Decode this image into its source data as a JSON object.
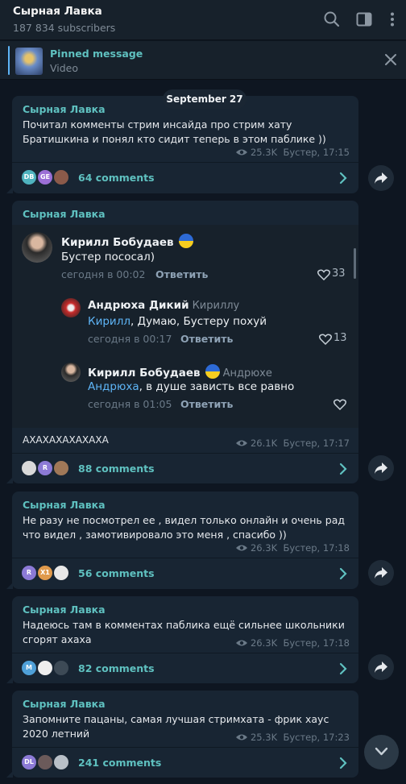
{
  "channel": {
    "title": "Сырная Лавка",
    "subscribers": "187 834 subscribers"
  },
  "header_icons": [
    "search-icon",
    "sidebar-toggle-icon",
    "more-vertical-icon"
  ],
  "pinned": {
    "title": "Pinned message",
    "subtitle": "Video"
  },
  "date_separator": "September 27",
  "posts": [
    {
      "sender": "Сырная Лавка",
      "text": "Почитал комменты стрим инсайда про стрим хату Братишкина и понял кто сидит теперь в этом паблике ))",
      "views": "25.3K",
      "author_time": "Бустер, 17:15",
      "avatars": [
        "DB",
        "GE",
        ""
      ],
      "comments": "64 comments"
    },
    {
      "sender": "Сырная Лавка",
      "text": "АХАХАХАХАХАХА",
      "views": "26.1K",
      "author_time": "Бустер, 17:17",
      "avatars": [
        "",
        "R",
        ""
      ],
      "comments": "88 comments",
      "embedded_comments": [
        {
          "name": "Кирилл Бобудаев",
          "text": "Бустер пососал)",
          "time": "сегодня в 00:02",
          "answer": "Ответить",
          "likes": "33"
        },
        {
          "name": "Андрюха Дикий",
          "reply_to": "Кириллу",
          "mention": "Кирилл",
          "text": ", Думаю, Бустеру похуй",
          "time": "сегодня в 00:17",
          "answer": "Ответить",
          "likes": "13"
        },
        {
          "name": "Кирилл Бобудаев",
          "reply_to": "Андрюхе",
          "mention": "Андрюха",
          "text": ", в душе зависть все равно",
          "time": "сегодня в 01:05",
          "answer": "Ответить",
          "likes": ""
        }
      ]
    },
    {
      "sender": "Сырная Лавка",
      "text": "Не разу не посмотрел ее , видел только онлайн и очень рад что видел , замотивировало это меня , спасибо ))",
      "views": "26.3K",
      "author_time": "Бустер, 17:18",
      "avatars": [
        "R",
        "X1",
        ""
      ],
      "comments": "56 comments"
    },
    {
      "sender": "Сырная Лавка",
      "text": "Надеюсь там в комментах паблика ещё сильнее школьники сгорят ахаха",
      "views": "26.3K",
      "author_time": "Бустер, 17:18",
      "avatars": [
        "M",
        "",
        ""
      ],
      "comments": "82 comments"
    },
    {
      "sender": "Сырная Лавка",
      "text": "Запомните пацаны, самая лучшая стримхата - фрик хаус 2020 летний",
      "views": "25.3K",
      "author_time": "Бустер, 17:23",
      "avatars": [
        "DL",
        "",
        ""
      ],
      "comments": "241 comments"
    }
  ],
  "colors": {
    "background": "#0e1621",
    "bubble": "#182533",
    "accent": "#5fc1c0",
    "link": "#5eb5f7"
  }
}
